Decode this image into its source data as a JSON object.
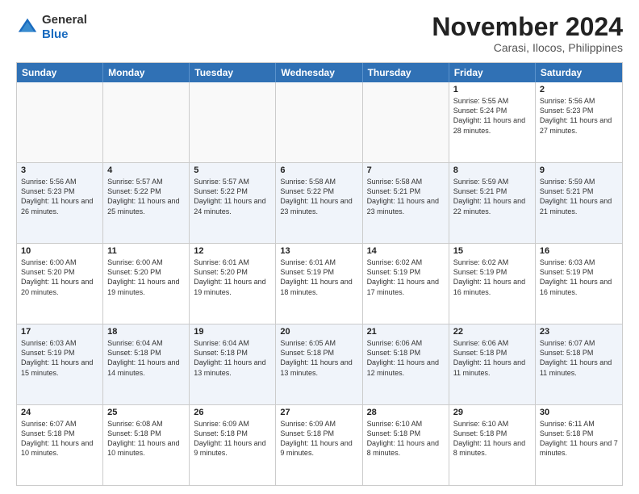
{
  "logo": {
    "general": "General",
    "blue": "Blue"
  },
  "header": {
    "month": "November 2024",
    "location": "Carasi, Ilocos, Philippines"
  },
  "weekdays": [
    "Sunday",
    "Monday",
    "Tuesday",
    "Wednesday",
    "Thursday",
    "Friday",
    "Saturday"
  ],
  "rows": [
    [
      {
        "day": "",
        "sunrise": "",
        "sunset": "",
        "daylight": "",
        "empty": true
      },
      {
        "day": "",
        "sunrise": "",
        "sunset": "",
        "daylight": "",
        "empty": true
      },
      {
        "day": "",
        "sunrise": "",
        "sunset": "",
        "daylight": "",
        "empty": true
      },
      {
        "day": "",
        "sunrise": "",
        "sunset": "",
        "daylight": "",
        "empty": true
      },
      {
        "day": "",
        "sunrise": "",
        "sunset": "",
        "daylight": "",
        "empty": true
      },
      {
        "day": "1",
        "sunrise": "Sunrise: 5:55 AM",
        "sunset": "Sunset: 5:24 PM",
        "daylight": "Daylight: 11 hours and 28 minutes.",
        "empty": false
      },
      {
        "day": "2",
        "sunrise": "Sunrise: 5:56 AM",
        "sunset": "Sunset: 5:23 PM",
        "daylight": "Daylight: 11 hours and 27 minutes.",
        "empty": false
      }
    ],
    [
      {
        "day": "3",
        "sunrise": "Sunrise: 5:56 AM",
        "sunset": "Sunset: 5:23 PM",
        "daylight": "Daylight: 11 hours and 26 minutes.",
        "empty": false
      },
      {
        "day": "4",
        "sunrise": "Sunrise: 5:57 AM",
        "sunset": "Sunset: 5:22 PM",
        "daylight": "Daylight: 11 hours and 25 minutes.",
        "empty": false
      },
      {
        "day": "5",
        "sunrise": "Sunrise: 5:57 AM",
        "sunset": "Sunset: 5:22 PM",
        "daylight": "Daylight: 11 hours and 24 minutes.",
        "empty": false
      },
      {
        "day": "6",
        "sunrise": "Sunrise: 5:58 AM",
        "sunset": "Sunset: 5:22 PM",
        "daylight": "Daylight: 11 hours and 23 minutes.",
        "empty": false
      },
      {
        "day": "7",
        "sunrise": "Sunrise: 5:58 AM",
        "sunset": "Sunset: 5:21 PM",
        "daylight": "Daylight: 11 hours and 23 minutes.",
        "empty": false
      },
      {
        "day": "8",
        "sunrise": "Sunrise: 5:59 AM",
        "sunset": "Sunset: 5:21 PM",
        "daylight": "Daylight: 11 hours and 22 minutes.",
        "empty": false
      },
      {
        "day": "9",
        "sunrise": "Sunrise: 5:59 AM",
        "sunset": "Sunset: 5:21 PM",
        "daylight": "Daylight: 11 hours and 21 minutes.",
        "empty": false
      }
    ],
    [
      {
        "day": "10",
        "sunrise": "Sunrise: 6:00 AM",
        "sunset": "Sunset: 5:20 PM",
        "daylight": "Daylight: 11 hours and 20 minutes.",
        "empty": false
      },
      {
        "day": "11",
        "sunrise": "Sunrise: 6:00 AM",
        "sunset": "Sunset: 5:20 PM",
        "daylight": "Daylight: 11 hours and 19 minutes.",
        "empty": false
      },
      {
        "day": "12",
        "sunrise": "Sunrise: 6:01 AM",
        "sunset": "Sunset: 5:20 PM",
        "daylight": "Daylight: 11 hours and 19 minutes.",
        "empty": false
      },
      {
        "day": "13",
        "sunrise": "Sunrise: 6:01 AM",
        "sunset": "Sunset: 5:19 PM",
        "daylight": "Daylight: 11 hours and 18 minutes.",
        "empty": false
      },
      {
        "day": "14",
        "sunrise": "Sunrise: 6:02 AM",
        "sunset": "Sunset: 5:19 PM",
        "daylight": "Daylight: 11 hours and 17 minutes.",
        "empty": false
      },
      {
        "day": "15",
        "sunrise": "Sunrise: 6:02 AM",
        "sunset": "Sunset: 5:19 PM",
        "daylight": "Daylight: 11 hours and 16 minutes.",
        "empty": false
      },
      {
        "day": "16",
        "sunrise": "Sunrise: 6:03 AM",
        "sunset": "Sunset: 5:19 PM",
        "daylight": "Daylight: 11 hours and 16 minutes.",
        "empty": false
      }
    ],
    [
      {
        "day": "17",
        "sunrise": "Sunrise: 6:03 AM",
        "sunset": "Sunset: 5:19 PM",
        "daylight": "Daylight: 11 hours and 15 minutes.",
        "empty": false
      },
      {
        "day": "18",
        "sunrise": "Sunrise: 6:04 AM",
        "sunset": "Sunset: 5:18 PM",
        "daylight": "Daylight: 11 hours and 14 minutes.",
        "empty": false
      },
      {
        "day": "19",
        "sunrise": "Sunrise: 6:04 AM",
        "sunset": "Sunset: 5:18 PM",
        "daylight": "Daylight: 11 hours and 13 minutes.",
        "empty": false
      },
      {
        "day": "20",
        "sunrise": "Sunrise: 6:05 AM",
        "sunset": "Sunset: 5:18 PM",
        "daylight": "Daylight: 11 hours and 13 minutes.",
        "empty": false
      },
      {
        "day": "21",
        "sunrise": "Sunrise: 6:06 AM",
        "sunset": "Sunset: 5:18 PM",
        "daylight": "Daylight: 11 hours and 12 minutes.",
        "empty": false
      },
      {
        "day": "22",
        "sunrise": "Sunrise: 6:06 AM",
        "sunset": "Sunset: 5:18 PM",
        "daylight": "Daylight: 11 hours and 11 minutes.",
        "empty": false
      },
      {
        "day": "23",
        "sunrise": "Sunrise: 6:07 AM",
        "sunset": "Sunset: 5:18 PM",
        "daylight": "Daylight: 11 hours and 11 minutes.",
        "empty": false
      }
    ],
    [
      {
        "day": "24",
        "sunrise": "Sunrise: 6:07 AM",
        "sunset": "Sunset: 5:18 PM",
        "daylight": "Daylight: 11 hours and 10 minutes.",
        "empty": false
      },
      {
        "day": "25",
        "sunrise": "Sunrise: 6:08 AM",
        "sunset": "Sunset: 5:18 PM",
        "daylight": "Daylight: 11 hours and 10 minutes.",
        "empty": false
      },
      {
        "day": "26",
        "sunrise": "Sunrise: 6:09 AM",
        "sunset": "Sunset: 5:18 PM",
        "daylight": "Daylight: 11 hours and 9 minutes.",
        "empty": false
      },
      {
        "day": "27",
        "sunrise": "Sunrise: 6:09 AM",
        "sunset": "Sunset: 5:18 PM",
        "daylight": "Daylight: 11 hours and 9 minutes.",
        "empty": false
      },
      {
        "day": "28",
        "sunrise": "Sunrise: 6:10 AM",
        "sunset": "Sunset: 5:18 PM",
        "daylight": "Daylight: 11 hours and 8 minutes.",
        "empty": false
      },
      {
        "day": "29",
        "sunrise": "Sunrise: 6:10 AM",
        "sunset": "Sunset: 5:18 PM",
        "daylight": "Daylight: 11 hours and 8 minutes.",
        "empty": false
      },
      {
        "day": "30",
        "sunrise": "Sunrise: 6:11 AM",
        "sunset": "Sunset: 5:18 PM",
        "daylight": "Daylight: 11 hours and 7 minutes.",
        "empty": false
      }
    ]
  ]
}
